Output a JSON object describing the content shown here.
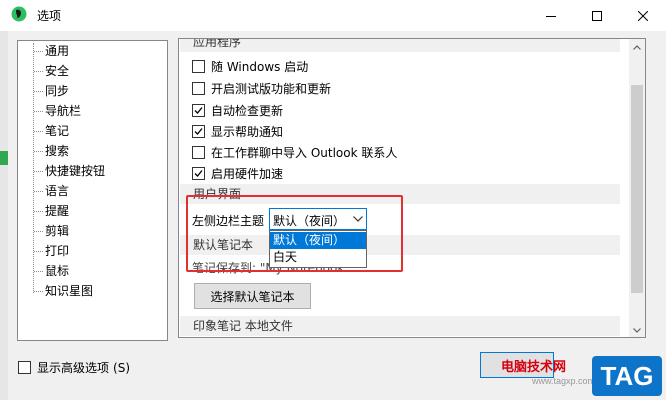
{
  "window": {
    "title": "选项"
  },
  "sidebar": {
    "items": [
      {
        "label": "通用"
      },
      {
        "label": "安全"
      },
      {
        "label": "同步"
      },
      {
        "label": "导航栏"
      },
      {
        "label": "笔记"
      },
      {
        "label": "搜索"
      },
      {
        "label": "快捷键按钮"
      },
      {
        "label": "语言"
      },
      {
        "label": "提醒"
      },
      {
        "label": "剪辑"
      },
      {
        "label": "打印"
      },
      {
        "label": "鼠标"
      },
      {
        "label": "知识星图"
      }
    ]
  },
  "content": {
    "app_section_title": "应用程序",
    "options": [
      {
        "label": "随 Windows 启动",
        "checked": false
      },
      {
        "label": "开启测试版功能和更新",
        "checked": false
      },
      {
        "label": "自动检查更新",
        "checked": true
      },
      {
        "label": "显示帮助通知",
        "checked": true
      },
      {
        "label": "在工作群聊中导入 Outlook 联系人",
        "checked": false
      },
      {
        "label": "启用硬件加速",
        "checked": true
      }
    ],
    "ui_section_title": "用户界面",
    "sidebar_theme_label": "左侧边栏主题",
    "sidebar_theme_value": "默认（夜间）",
    "sidebar_theme_options": [
      "默认（夜间）",
      "白天"
    ],
    "default_notebook_title": "默认笔记本",
    "notebook_save_path": "笔记保存到: \"My Notebook\"",
    "choose_notebook_button": "选择默认笔记本",
    "local_files_section_title": "印象笔记 本地文件"
  },
  "footer": {
    "show_advanced_label": "显示高级选项",
    "show_advanced_shortcut": "(S)",
    "show_advanced_checked": false
  },
  "watermark": {
    "site_name": "电脑技术网",
    "url": "www.tagxp.com",
    "logo": "TAG"
  },
  "colors": {
    "accent": "#0078d7",
    "highlight_box": "#e0312f",
    "section_header_bg": "#f0f0f0"
  }
}
